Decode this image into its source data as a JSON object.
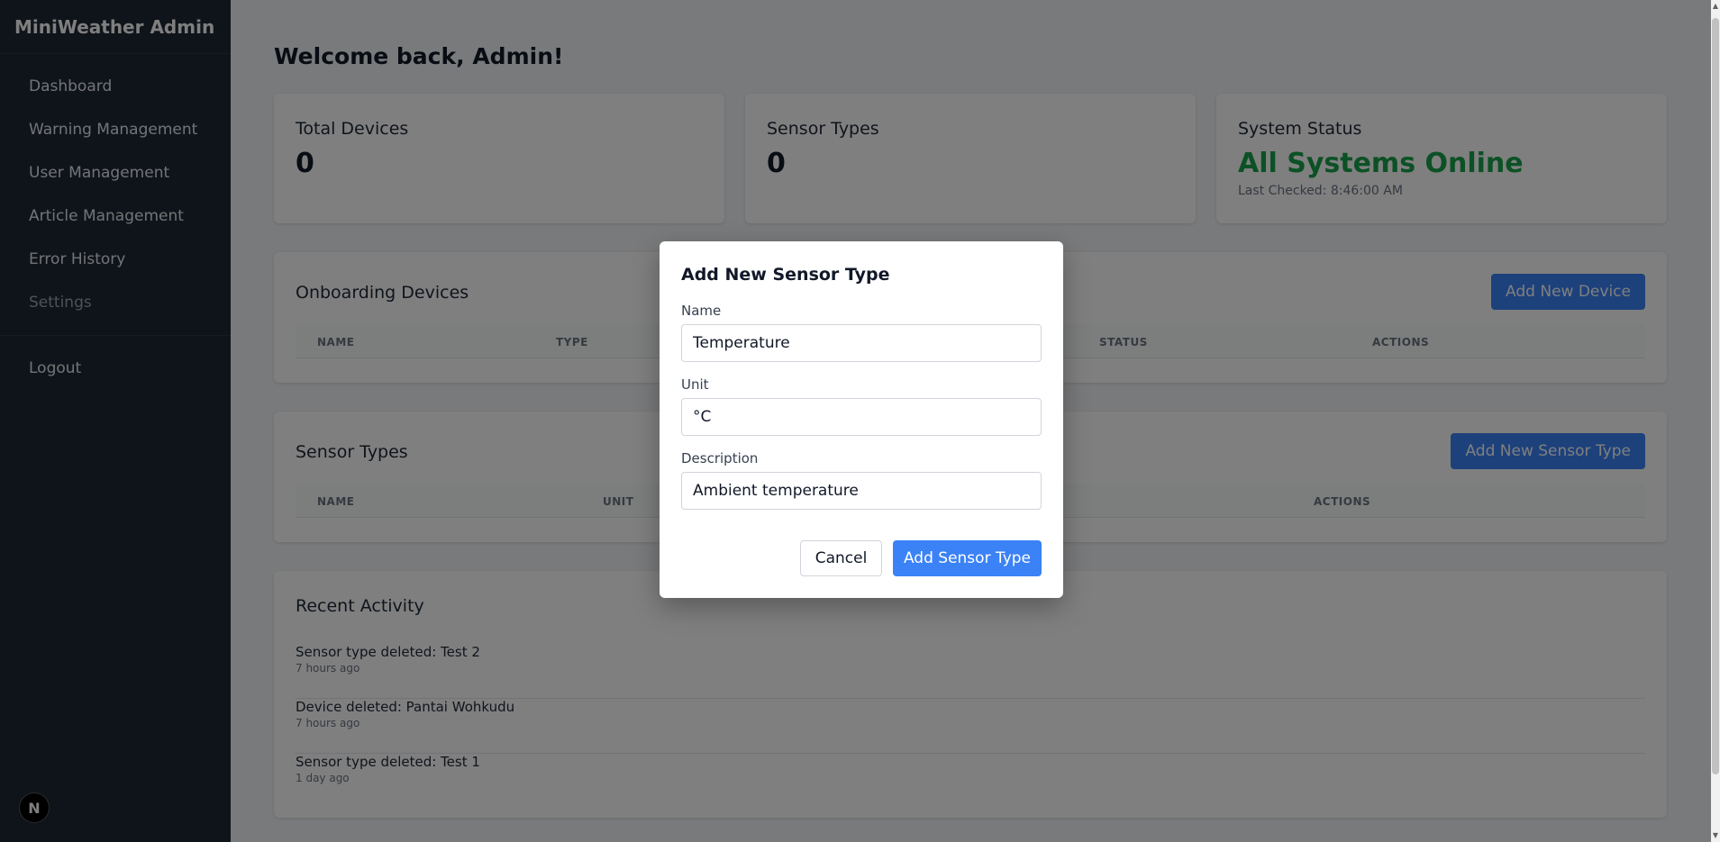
{
  "sidebar": {
    "brand": "MiniWeather Admin",
    "items": [
      {
        "label": "Dashboard"
      },
      {
        "label": "Warning Management"
      },
      {
        "label": "User Management"
      },
      {
        "label": "Article Management"
      },
      {
        "label": "Error History"
      },
      {
        "label": "Settings"
      }
    ],
    "logout_label": "Logout",
    "badge_letter": "N"
  },
  "main": {
    "welcome": "Welcome back, Admin!",
    "stats": {
      "total_devices_title": "Total Devices",
      "total_devices_value": "0",
      "sensor_types_title": "Sensor Types",
      "sensor_types_value": "0",
      "system_status_title": "System Status",
      "system_status_value": "All Systems Online",
      "last_checked": "Last Checked: 8:46:00 AM"
    },
    "onboarding": {
      "title": "Onboarding Devices",
      "add_button": "Add New Device",
      "columns": [
        "NAME",
        "TYPE",
        "STATUS",
        "ACTIONS"
      ]
    },
    "sensor_types": {
      "title": "Sensor Types",
      "add_button": "Add New Sensor Type",
      "columns": [
        "NAME",
        "UNIT",
        "ACTIONS"
      ]
    },
    "recent_activity": {
      "title": "Recent Activity",
      "items": [
        {
          "text": "Sensor type deleted: Test 2",
          "time": "7 hours ago"
        },
        {
          "text": "Device deleted: Pantai Wohkudu",
          "time": "7 hours ago"
        },
        {
          "text": "Sensor type deleted: Test 1",
          "time": "1 day ago"
        }
      ]
    }
  },
  "modal": {
    "title": "Add New Sensor Type",
    "name_label": "Name",
    "name_value": "Temperature",
    "unit_label": "Unit",
    "unit_value": "°C",
    "description_label": "Description",
    "description_value": "Ambient temperature",
    "cancel_label": "Cancel",
    "submit_label": "Add Sensor Type"
  },
  "colors": {
    "sidebar_bg": "#1f2937",
    "accent": "#3b82f6",
    "status_green": "#16a34a"
  }
}
